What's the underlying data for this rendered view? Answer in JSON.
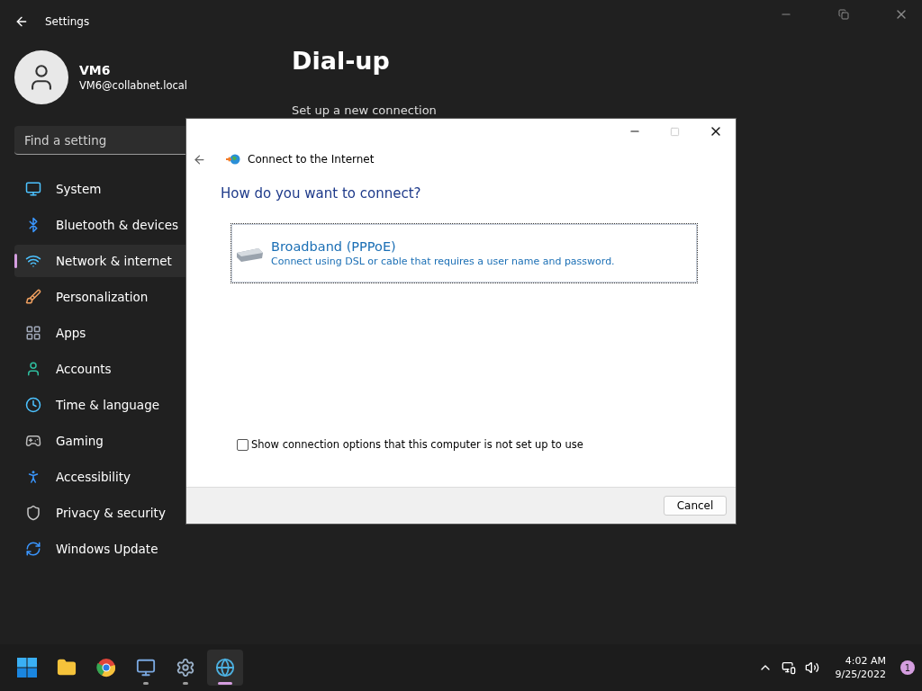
{
  "settings": {
    "title": "Settings",
    "user": {
      "name": "VM6",
      "email": "VM6@collabnet.local"
    },
    "search": {
      "placeholder": "Find a setting"
    },
    "nav": [
      {
        "label": "System",
        "kind": "system",
        "selected": false
      },
      {
        "label": "Bluetooth & devices",
        "kind": "bluetooth",
        "selected": false
      },
      {
        "label": "Network & internet",
        "kind": "network",
        "selected": true
      },
      {
        "label": "Personalization",
        "kind": "brush",
        "selected": false
      },
      {
        "label": "Apps",
        "kind": "apps",
        "selected": false
      },
      {
        "label": "Accounts",
        "kind": "accounts",
        "selected": false
      },
      {
        "label": "Time & language",
        "kind": "time",
        "selected": false
      },
      {
        "label": "Gaming",
        "kind": "gaming",
        "selected": false
      },
      {
        "label": "Accessibility",
        "kind": "accessibility",
        "selected": false
      },
      {
        "label": "Privacy & security",
        "kind": "privacy",
        "selected": false
      },
      {
        "label": "Windows Update",
        "kind": "update",
        "selected": false
      }
    ],
    "page": {
      "title": "Dial-up",
      "subtitle": "Set up a new connection"
    }
  },
  "dialog": {
    "title": "Connect to the Internet",
    "heading": "How do you want to connect?",
    "options": [
      {
        "title": "Broadband (PPPoE)",
        "description": "Connect using DSL or cable that requires a user name and password."
      }
    ],
    "show_all": {
      "label": "Show connection options that this computer is not set up to use",
      "checked": false
    },
    "buttons": [
      "Cancel"
    ]
  },
  "taskbar": {
    "apps": [
      {
        "kind": "start",
        "running": false,
        "active": false
      },
      {
        "kind": "files",
        "running": false,
        "active": false
      },
      {
        "kind": "browser",
        "running": false,
        "active": false
      },
      {
        "kind": "remote",
        "running": true,
        "active": false
      },
      {
        "kind": "settings",
        "running": true,
        "active": false
      },
      {
        "kind": "connect",
        "running": true,
        "active": true
      }
    ],
    "time": "4:02 AM",
    "date": "9/25/2022",
    "notifications": "1"
  }
}
